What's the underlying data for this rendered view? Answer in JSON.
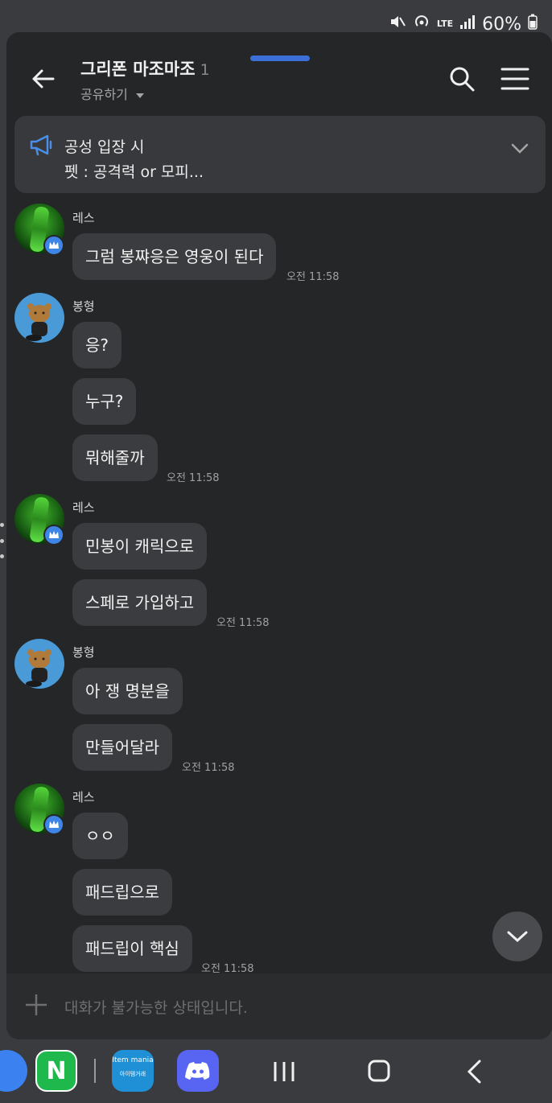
{
  "status": {
    "battery": "60%",
    "lte": "LTE"
  },
  "header": {
    "title": "그리폰 마조마조",
    "member_count": "1",
    "subtitle": "공유하기"
  },
  "notice": {
    "line1": "공성 입장 시",
    "line2": "펫 : 공격력 or 모피..."
  },
  "messages": {
    "g1": {
      "sender": "레스",
      "m1": "그럼 봉쨔응은 영웅이 된다",
      "time": "오전 11:58"
    },
    "g2": {
      "sender": "봉형",
      "m1": "응?",
      "m2": "누구?",
      "m3": "뭐해줄까",
      "time": "오전 11:58"
    },
    "g3": {
      "sender": "레스",
      "m1": "민봉이 캐릭으로",
      "m2": "스페로 가입하고",
      "time": "오전 11:58"
    },
    "g4": {
      "sender": "봉형",
      "m1": "아 쟁 명분을",
      "m2": "만들어달라",
      "time": "오전 11:58"
    },
    "g5": {
      "sender": "레스",
      "m1": "ㅇㅇ",
      "m2": "패드립으로",
      "m3": "패드립이 핵심",
      "time": "오전 11:58"
    }
  },
  "input": {
    "placeholder": "대화가 불가능한 상태입니다."
  },
  "dock": {
    "naver": "N",
    "itemmania_top": "Item mania",
    "itemmania_bottom": "아이템거래"
  },
  "colors": {
    "accent": "#3d6fd8",
    "window_bg": "#252628",
    "bubble": "#3b3c3f"
  }
}
